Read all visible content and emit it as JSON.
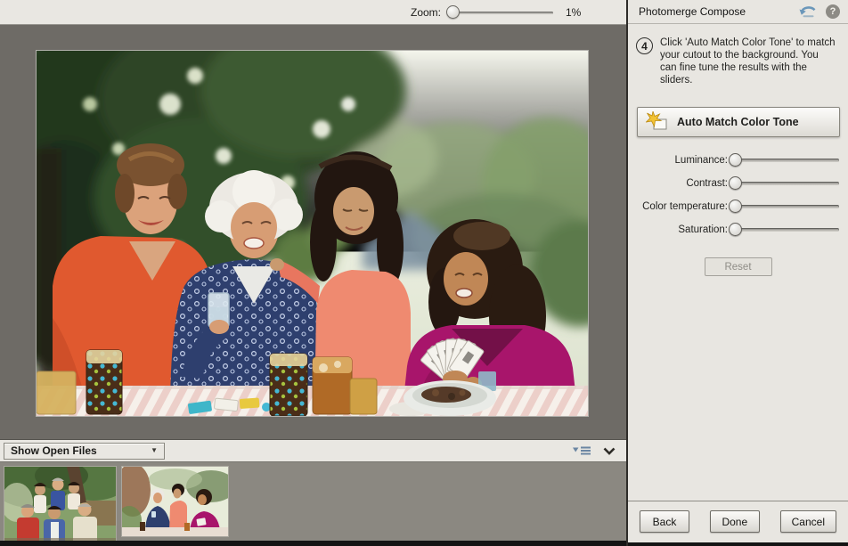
{
  "top_bar": {
    "zoom_label": "Zoom:",
    "zoom_value": "1%"
  },
  "panel": {
    "title": "Photomerge Compose",
    "step_number": "4",
    "step_text": "Click 'Auto Match Color Tone' to match your cutout to the background. You can fine tune the results with the sliders.",
    "auto_match_label": "Auto Match Color Tone",
    "sliders": [
      {
        "label": "Luminance:"
      },
      {
        "label": "Contrast:"
      },
      {
        "label": "Color temperature:"
      },
      {
        "label": "Saturation:"
      }
    ],
    "reset_label": "Reset",
    "footer": {
      "back_label": "Back",
      "done_label": "Done",
      "cancel_label": "Cancel"
    }
  },
  "bin": {
    "show_open_files_label": "Show Open Files",
    "thumbnail_count": 2
  },
  "icons": {
    "undo": "undo-arrow",
    "help": "?",
    "dropdown_arrow": "▼",
    "panel_menu": "panel-menu",
    "collapse": "chevron-down",
    "auto_match": "sparkle-page",
    "step_badge": "circled-number"
  },
  "colors": {
    "panel_bg": "#E8E6E1",
    "canvas_bg": "#6E6B66",
    "bin_bg": "#8B8881",
    "undo_icon_blue": "#6B97BA",
    "divider": "#2E2C29"
  }
}
